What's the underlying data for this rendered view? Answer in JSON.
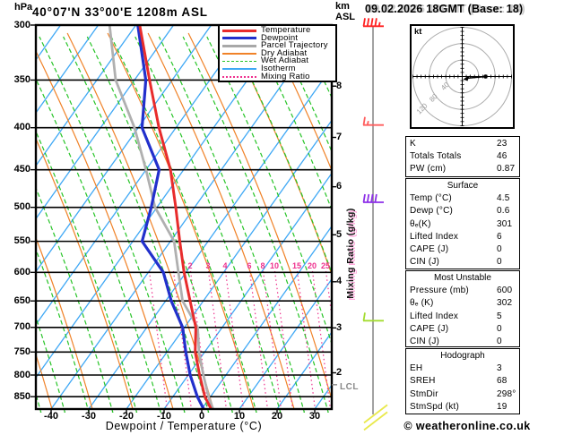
{
  "header": {
    "pressure_unit": "hPa",
    "title": "40°07'N 33°00'E 1208m ASL",
    "alt_unit_1": "km",
    "alt_unit_2": "ASL",
    "datetime": "09.02.2026 18GMT (Base: 18)"
  },
  "legend": {
    "items": [
      {
        "label": "Temperature",
        "color": "#e82c2c",
        "kind": "thick"
      },
      {
        "label": "Dewpoint",
        "color": "#2230cc",
        "kind": "thick"
      },
      {
        "label": "Parcel Trajectory",
        "color": "#a8a8a8",
        "kind": "thick"
      },
      {
        "label": "Dry Adiabat",
        "color": "#f08228",
        "kind": "thin"
      },
      {
        "label": "Wet Adiabat",
        "color": "#27c427",
        "kind": "dashed"
      },
      {
        "label": "Isotherm",
        "color": "#3fa8f5",
        "kind": "thin"
      },
      {
        "label": "Mixing Ratio",
        "color": "#ee2f8d",
        "kind": "dotted"
      }
    ]
  },
  "axes": {
    "xlabel": "Dewpoint / Temperature (°C)",
    "mixing_ratio_label": "Mixing Ratio (g/kg)",
    "lcl_label": "LCL",
    "pressure_ticks": [
      300,
      350,
      400,
      450,
      500,
      550,
      600,
      650,
      700,
      750,
      800,
      850
    ],
    "temp_ticks": [
      -40,
      -30,
      -20,
      -10,
      0,
      10,
      20,
      30
    ],
    "altitude_ticks_km": [
      2,
      3,
      4,
      5,
      6,
      7,
      8
    ]
  },
  "chart_data": {
    "type": "skewt_sounding",
    "pressure_axis": {
      "unit": "hPa",
      "top": 300,
      "bottom": 880,
      "scale": "log"
    },
    "temp_axis": {
      "unit": "°C",
      "min": -40,
      "max": 35,
      "label": "Dewpoint / Temperature (°C)"
    },
    "altitude_axis": {
      "unit": "km ASL",
      "ticks": [
        2,
        3,
        4,
        5,
        6,
        7,
        8
      ]
    },
    "series": [
      {
        "name": "Temperature",
        "color": "#e82c2c",
        "width": 3,
        "points": [
          [
            300,
            -89
          ],
          [
            350,
            -76
          ],
          [
            400,
            -64.5
          ],
          [
            450,
            -53.5
          ],
          [
            500,
            -45
          ],
          [
            550,
            -37.5
          ],
          [
            600,
            -30.5
          ],
          [
            650,
            -23.5
          ],
          [
            700,
            -17
          ],
          [
            750,
            -12.5
          ],
          [
            800,
            -7
          ],
          [
            850,
            -1.5
          ],
          [
            880,
            2.5
          ]
        ]
      },
      {
        "name": "Dewpoint",
        "color": "#2230cc",
        "width": 3.2,
        "points": [
          [
            300,
            -89.5
          ],
          [
            350,
            -77
          ],
          [
            400,
            -69
          ],
          [
            450,
            -56.5
          ],
          [
            500,
            -51.5
          ],
          [
            550,
            -47.5
          ],
          [
            600,
            -36
          ],
          [
            650,
            -28.5
          ],
          [
            700,
            -20.5
          ],
          [
            750,
            -15
          ],
          [
            800,
            -9.5
          ],
          [
            850,
            -3.5
          ],
          [
            880,
            0.5
          ]
        ]
      },
      {
        "name": "Parcel Trajectory",
        "color": "#b0b0b0",
        "width": 2.8,
        "points": [
          [
            300,
            -97
          ],
          [
            350,
            -85
          ],
          [
            400,
            -71
          ],
          [
            450,
            -60
          ],
          [
            500,
            -50.5
          ],
          [
            550,
            -39
          ],
          [
            600,
            -32
          ],
          [
            650,
            -25.5
          ],
          [
            700,
            -16.5
          ],
          [
            750,
            -11.5
          ],
          [
            800,
            -6
          ],
          [
            850,
            -0.5
          ],
          [
            880,
            3
          ]
        ]
      }
    ],
    "mixing_ratio_lines": [
      {
        "value": 1,
        "x": 166,
        "labeled": false
      },
      {
        "value": 1.5,
        "x": 193,
        "labeled": false
      },
      {
        "value": 2,
        "x": 212,
        "labeled": true
      },
      {
        "value": 3,
        "x": 232,
        "labeled": true
      },
      {
        "value": 4,
        "x": 251,
        "labeled": true
      },
      {
        "value": 6,
        "x": 278,
        "labeled": true
      },
      {
        "value": 8,
        "x": 293,
        "labeled": true
      },
      {
        "value": 10,
        "x": 306,
        "labeled": true
      },
      {
        "value": 15,
        "x": 331,
        "labeled": true
      },
      {
        "value": 20,
        "x": 348,
        "labeled": true
      },
      {
        "value": 25,
        "x": 363,
        "labeled": true
      }
    ],
    "wind_barbs": [
      {
        "pressure": 301,
        "color": "#ff2222",
        "full": 4,
        "half": 1,
        "type": "barb"
      },
      {
        "pressure": 397,
        "color": "#ff5d5d",
        "full": 1,
        "half": 1,
        "type": "barb"
      },
      {
        "pressure": 493,
        "color": "#8d2fe8",
        "full": 4,
        "half": 0,
        "type": "barb"
      },
      {
        "pressure": 687,
        "color": "#a4dc30",
        "full": 1,
        "half": 0,
        "type": "barb"
      },
      {
        "pressure": 892,
        "color": "#e9e94c",
        "type": "calm_lines"
      }
    ],
    "lcl_pressure": 822
  },
  "hodograph": {
    "unit_label": "kt",
    "ring_labels": [
      "40",
      "80",
      "120"
    ],
    "ring_radii_kt": [
      40,
      80,
      120
    ],
    "trace": {
      "dot": [
        541.5,
        85.5
      ],
      "arrow_tip": [
        516.5,
        88.5
      ]
    }
  },
  "indices": {
    "sections": [
      {
        "title": "",
        "rows": [
          {
            "label": "K",
            "value": "23"
          },
          {
            "label": "Totals Totals",
            "value": "46"
          },
          {
            "label": "PW (cm)",
            "value": "0.87"
          }
        ]
      },
      {
        "title": "Surface",
        "rows": [
          {
            "label": "Temp (°C)",
            "value": "4.5"
          },
          {
            "label": "Dewp (°C)",
            "value": "0.6"
          },
          {
            "label": "θₑ(K)",
            "value": "301"
          },
          {
            "label": "Lifted Index",
            "value": "6"
          },
          {
            "label": "CAPE (J)",
            "value": "0"
          },
          {
            "label": "CIN (J)",
            "value": "0"
          }
        ]
      },
      {
        "title": "Most Unstable",
        "rows": [
          {
            "label": "Pressure (mb)",
            "value": "600"
          },
          {
            "label": "θₑ (K)",
            "value": "302"
          },
          {
            "label": "Lifted Index",
            "value": "5"
          },
          {
            "label": "CAPE (J)",
            "value": "0"
          },
          {
            "label": "CIN (J)",
            "value": "0"
          }
        ]
      },
      {
        "title": "Hodograph",
        "rows": [
          {
            "label": "EH",
            "value": "3"
          },
          {
            "label": "SREH",
            "value": "68"
          },
          {
            "label": "StmDir",
            "value": "298°"
          },
          {
            "label": "StmSpd (kt)",
            "value": "19"
          }
        ]
      }
    ]
  },
  "footer": {
    "credit": "© weatheronline.co.uk"
  }
}
